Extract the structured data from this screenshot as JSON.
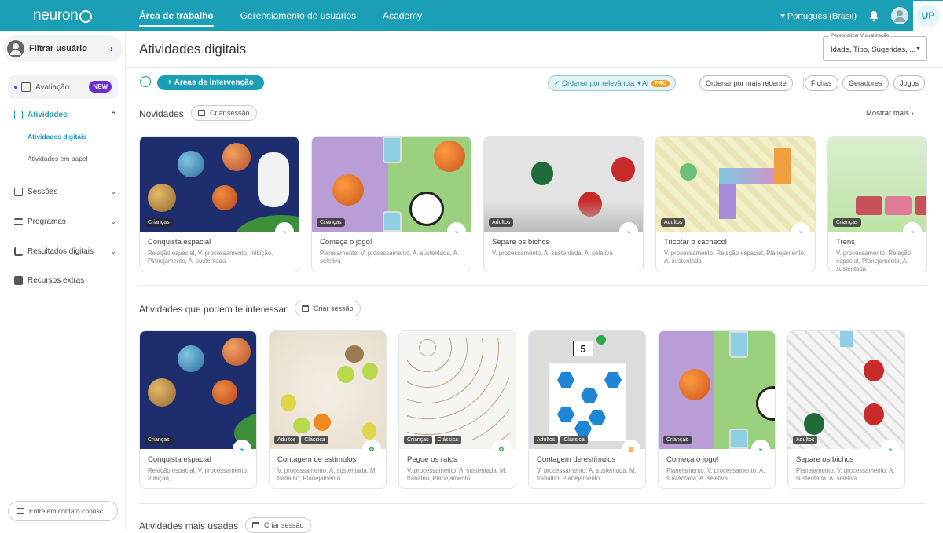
{
  "topbar": {
    "logo": "neuron",
    "tabs": [
      "Área de trabalho",
      "Gerenciamento de usuários",
      "Academy"
    ],
    "language": "Português (Brasil)",
    "up_badge": "UP"
  },
  "sidebar": {
    "filter_user": "Filtrar usuário",
    "evaluation": "Avaliação",
    "new_badge": "NEW",
    "items": {
      "activities": "Atividades",
      "digital": "Atividades digitais",
      "paper": "Atividades em papel",
      "sessions": "Sessões",
      "programs": "Programas",
      "results": "Resultados digitais",
      "extras": "Recursos extras"
    },
    "contact": "Entre em contato conosc..."
  },
  "main": {
    "title": "Atividades digitais",
    "personalize_label": "Personalizar Visualização",
    "personalize_value": "Idade, Tipo, Sugeridas, ...",
    "areas_button": "+ Áreas de intervenção",
    "sort_relevance": "Ordenar por relevância",
    "ai_label": "Ai",
    "pro_badge": "PRO",
    "sort_recent": "Ordenar por mais recente",
    "filters": [
      "Fichas",
      "Geradores",
      "Jogos"
    ],
    "create_session": "Criar sessão",
    "show_more": "Mostrar mais"
  },
  "sections": [
    {
      "title": "Novidades",
      "cards": [
        {
          "title": "Conquista espacial",
          "tags": [
            "Crianças"
          ],
          "desc": "Relação espacial, V. processamento, Inibição, Planejamento, A. sustentada",
          "icon": "gamepad-icon"
        },
        {
          "title": "Começa o jogo!",
          "tags": [
            "Crianças"
          ],
          "desc": "Planejamento, V. processamento, A. sustentada, A. seletiva",
          "icon": "gamepad-icon"
        },
        {
          "title": "Separe os bichos",
          "tags": [
            "Adultos"
          ],
          "desc": "V. processamento, A. sustentada, A. seletiva",
          "icon": "gamepad-icon"
        },
        {
          "title": "Tricotar o cachecol",
          "tags": [
            "Adultos"
          ],
          "desc": "V. processamento, Relação espacial, Planejamento, A. sustentada",
          "icon": "gamepad-icon"
        },
        {
          "title": "Trens",
          "tags": [
            "Crianças"
          ],
          "desc": "V. processamento, Relação espacial, Planejamento, A. sustentada",
          "icon": "gamepad-icon"
        }
      ]
    },
    {
      "title": "Atividades que podem te interessar",
      "cards": [
        {
          "title": "Conquista espacial",
          "tags": [
            "Crianças"
          ],
          "desc": "Relação espacial, V. processamento, Inibição,...",
          "icon": "gamepad-icon"
        },
        {
          "title": "Contagem de estímulos",
          "tags": [
            "Adultos",
            "Clássica"
          ],
          "desc": "V. processamento, A. sustentada, M. trabalho, Planejamento",
          "icon": "generator-icon"
        },
        {
          "title": "Pegue os ratos",
          "tags": [
            "Crianças",
            "Clássica"
          ],
          "desc": "V. processamento, A. sustentada, M. trabalho, Planejamento",
          "icon": "generator-icon"
        },
        {
          "title": "Contagem de estímulos",
          "tags": [
            "Adultos",
            "Clássica"
          ],
          "desc": "V. processamento, A. sustentada, M. trabalho, Planejamento",
          "icon": "worksheet-icon",
          "counter": "5"
        },
        {
          "title": "Começa o jogo!",
          "tags": [
            "Crianças"
          ],
          "desc": "Planejamento, V. processamento, A. sustentada, A. seletiva",
          "icon": "gamepad-icon"
        },
        {
          "title": "Separe os bichos",
          "tags": [
            "Adultos"
          ],
          "desc": "Planejamento, V. processamento, A. sustentada, A. seletiva",
          "icon": "gamepad-icon"
        }
      ]
    },
    {
      "title": "Atividades mais usadas"
    }
  ],
  "colors": {
    "brand": "#1a9fb6",
    "new_badge": "#6c2bd9",
    "pro_badge": "#f0a020"
  }
}
